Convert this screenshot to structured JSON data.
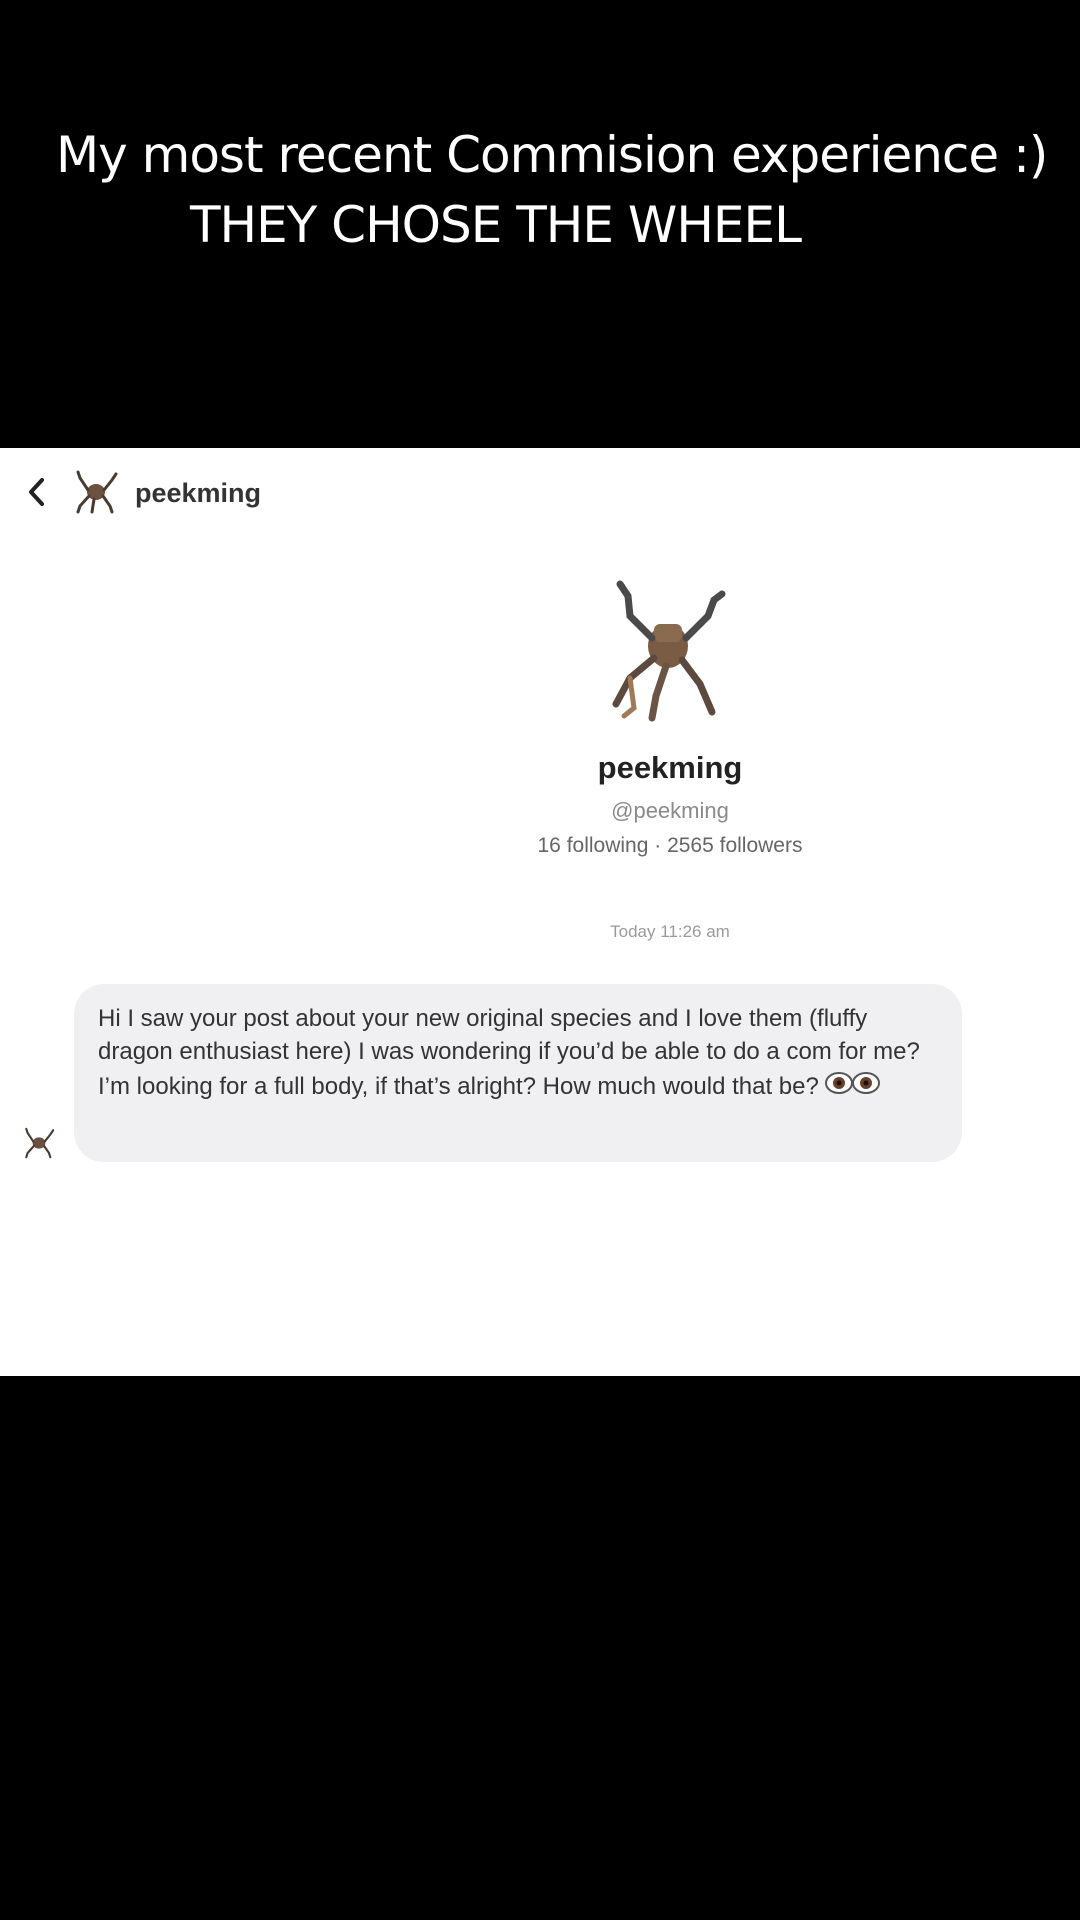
{
  "caption": {
    "line1": "My most recent Commision experience :)",
    "line2": "THEY CHOSE THE WHEEL"
  },
  "chat": {
    "header": {
      "back_icon": "chevron-left-icon",
      "username": "peekming"
    },
    "profile": {
      "display_name": "peekming",
      "handle": "@peekming",
      "stats": "16 following · 2565 followers"
    },
    "timestamp": "Today 11:26 am",
    "message": {
      "text": "Hi I saw your post about your new original species and I love them (fluffy dragon enthusiast here) I was wondering if you’d be able to do a com for me? I’m looking for a full body, if that’s alright? How much would that be?",
      "emoji": "eyes-emoji"
    }
  },
  "colors": {
    "background": "#000000",
    "chat_background": "#ffffff",
    "bubble": "#f0eff2",
    "caption_text": "#ffffff"
  }
}
